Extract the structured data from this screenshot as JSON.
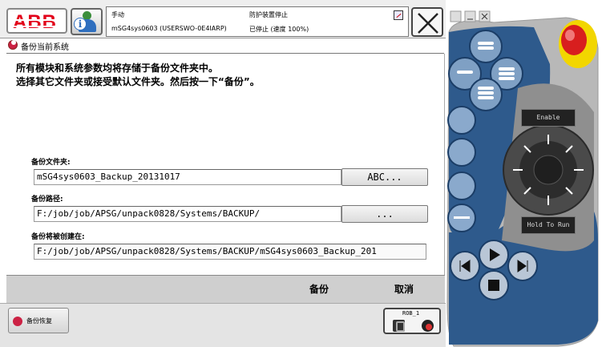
{
  "header": {
    "logo_text": "ABB",
    "mode": "手动",
    "system_name": "mSG4sys0603 (USERSWO-0E4IARP)",
    "guard_status": "防护装置停止",
    "run_state": "已停止 (速度 100%)"
  },
  "page": {
    "title": "备份当前系统",
    "description_line1": "所有模块和系统参数均将存储于备份文件夹中。",
    "description_line2": "选择其它文件夹或接受默认文件夹。然后按一下“备份”。"
  },
  "form": {
    "folder_label": "备份文件夹:",
    "folder_value": "mSG4sys0603_Backup_20131017",
    "folder_button": "ABC...",
    "path_label": "备份路径:",
    "path_value": "F:/job/job/APSG/unpack0828/Systems/BACKUP/",
    "path_button": "...",
    "created_label": "备份将被创建在:",
    "created_value": "F:/job/job/APSG/unpack0828/Systems/BACKUP/mSG4sys0603_Backup_201"
  },
  "commands": {
    "backup": "备份",
    "cancel": "取消"
  },
  "taskbar": {
    "backup_restore": "备份恢复",
    "rob_label": "ROB_1"
  },
  "pendant": {
    "enable_label": "Enable",
    "hold_to_run_label": "Hold To Run"
  },
  "colors": {
    "brand_red": "#e2001a",
    "pendant_blue": "#2e5a8c",
    "estop_red": "#d81e1e",
    "estop_yellow": "#f2d600"
  }
}
